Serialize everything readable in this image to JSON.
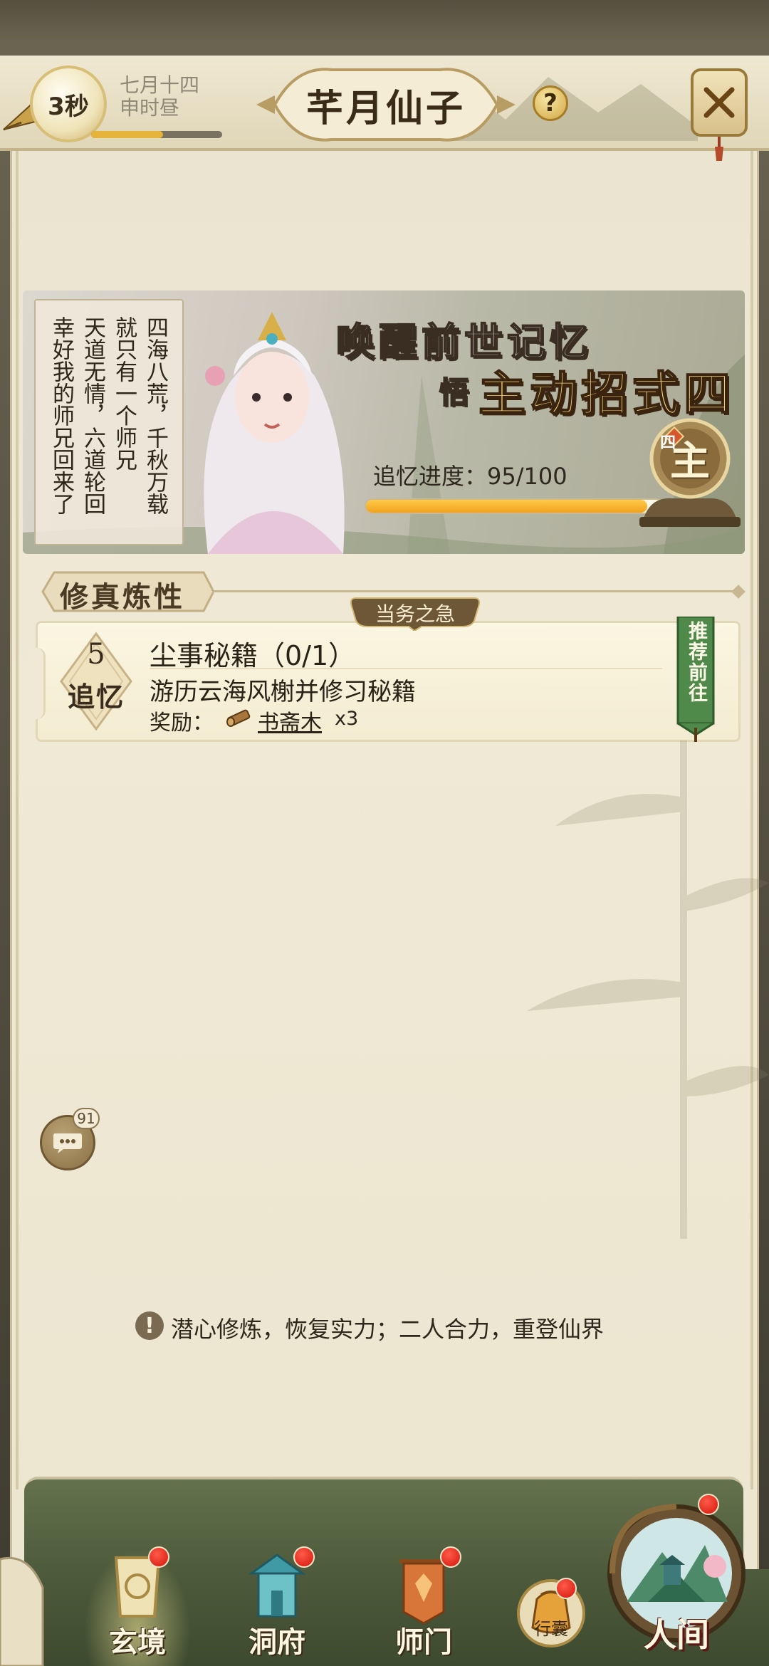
{
  "header": {
    "timer": "3秒",
    "date_line1": "七月十四",
    "date_line2": "申时昼",
    "time_progress": 0.55,
    "title": "芊月仙子",
    "help_glyph": "?"
  },
  "banner": {
    "poem_columns": [
      "四海八荒，千秋万载",
      "就只有一个师兄",
      "天道无情，六道轮回",
      "幸好我的师兄回来了"
    ],
    "headline1": "唤醒前世记忆",
    "headline2_prefix": "悟",
    "headline2_main": "主动招式四",
    "progress_label": "追忆进度：95/100",
    "progress_value": 95,
    "progress_max": 100,
    "skill_char": "主",
    "skill_tag": "四"
  },
  "section": {
    "title": "修真炼性"
  },
  "quest": {
    "urgent_label": "当务之急",
    "memory_count": "5",
    "memory_label": "追忆",
    "title": "尘事秘籍（0/1）",
    "description": "游历云海风榭并修习秘籍",
    "reward_label": "奖励：",
    "reward_item": "书斋木",
    "reward_count": "x3",
    "go_label": "推荐前往"
  },
  "chat": {
    "badge": "91"
  },
  "tip": {
    "icon": "!",
    "text": "潜心修炼，恢复实力；二人合力，重登仙界"
  },
  "nav": {
    "items": [
      {
        "label": "玄境",
        "icon": "scroll-icon"
      },
      {
        "label": "洞府",
        "icon": "pavilion-icon"
      },
      {
        "label": "师门",
        "icon": "banner-icon"
      }
    ],
    "bag_label": "行囊",
    "world_label": "人间"
  },
  "colors": {
    "accent_gold": "#e6b43a",
    "progress_orange": "#f0a21e",
    "nav_green": "#4e5c3d",
    "red_dot": "#d2160a"
  }
}
